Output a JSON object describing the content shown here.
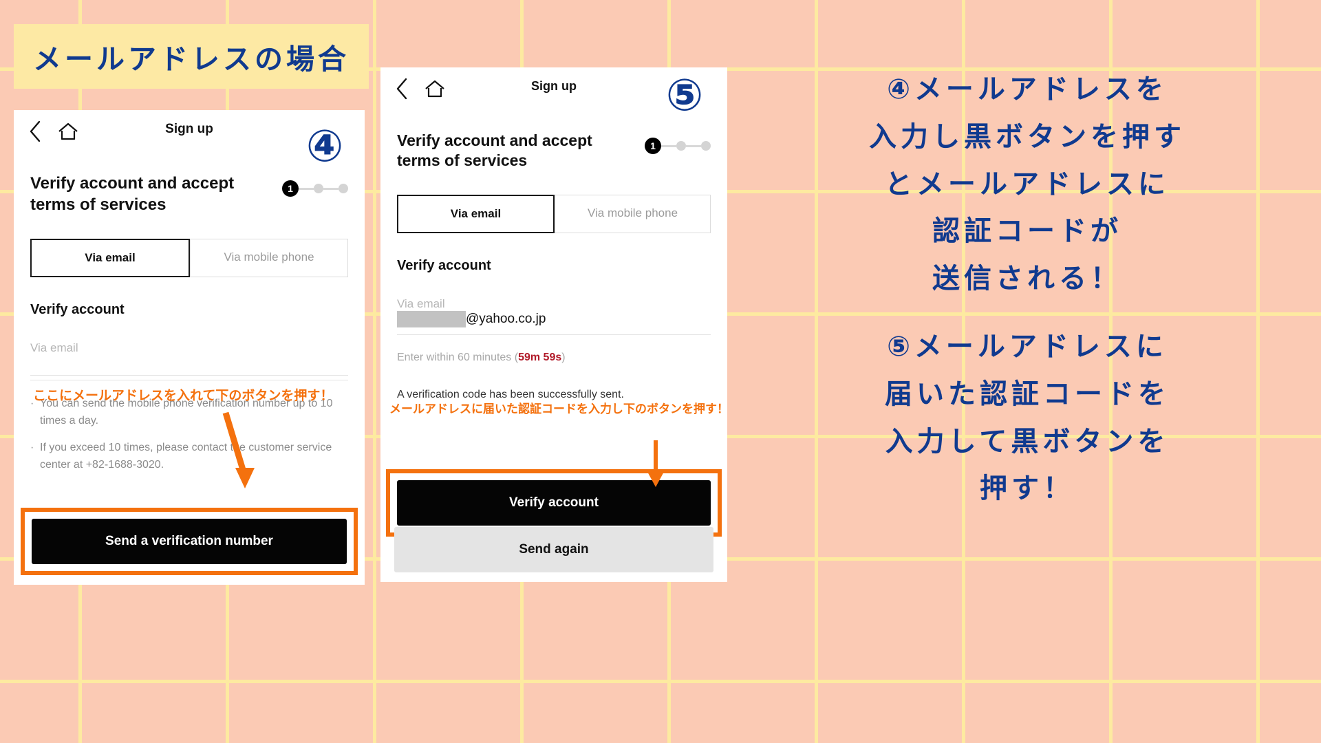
{
  "banner": {
    "title": "メールアドレスの場合"
  },
  "colors": {
    "background": "#fbcab4",
    "grid": "#fdeaa0",
    "banner_bg": "#fde9a4",
    "accent_blue": "#103a8f",
    "accent_orange": "#f4710e",
    "timer_red": "#b11a29",
    "button_black": "#050505",
    "button_gray": "#e4e4e4"
  },
  "phone_left": {
    "step_badge": "④",
    "nav": {
      "title": "Sign up",
      "back_icon": "chevron-left-icon",
      "home_icon": "home-icon"
    },
    "headline": "Verify account and accept terms of services",
    "progress": {
      "current": "1",
      "total_dots": 3
    },
    "tabs": [
      {
        "label": "Via email",
        "active": true
      },
      {
        "label": "Via mobile phone",
        "active": false
      }
    ],
    "section_title": "Verify account",
    "field": {
      "label": "Via email",
      "value": "",
      "placeholder": ""
    },
    "bullets": [
      "You can send the mobile phone verification number up to 10 times a day.",
      "If you exceed 10 times, please contact the customer service center at +82-1688-3020."
    ],
    "primary_button": "Send a verification number",
    "overlay_note": "ここにメールアドレスを入れて下のボタンを押す！"
  },
  "phone_right": {
    "step_badge": "⑤",
    "nav": {
      "title": "Sign up",
      "back_icon": "chevron-left-icon",
      "home_icon": "home-icon"
    },
    "headline": "Verify account and accept terms of services",
    "progress": {
      "current": "1",
      "total_dots": 3
    },
    "tabs": [
      {
        "label": "Via email",
        "active": true
      },
      {
        "label": "Via mobile phone",
        "active": false
      }
    ],
    "section_title": "Verify account",
    "field": {
      "label": "Via email",
      "value": "@yahoo.co.jp",
      "redacted": true
    },
    "timer": {
      "prefix": "Enter within 60 minutes (",
      "value": "59m 59s",
      "suffix": ")"
    },
    "info_text": "A verification code has been successfully sent.",
    "primary_button": "Verify account",
    "secondary_button": "Send again",
    "overlay_note": "メールアドレスに届いた認証コードを入力し下のボタンを押す！"
  },
  "instructions": {
    "step4": [
      "④メールアドレスを",
      "入力し黒ボタンを押す",
      "とメールアドレスに",
      "認証コードが",
      "送信される！"
    ],
    "step5": [
      "⑤メールアドレスに",
      "届いた認証コードを",
      "入力して黒ボタンを",
      "押す！"
    ]
  }
}
